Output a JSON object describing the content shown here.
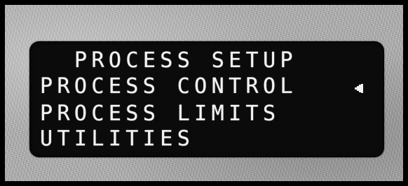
{
  "menu": {
    "title": "PROCESS SETUP",
    "items": [
      {
        "label": "PROCESS CONTROL",
        "selected": true
      },
      {
        "label": "PROCESS LIMITS",
        "selected": false
      },
      {
        "label": "UTILITIES",
        "selected": false
      }
    ]
  },
  "selection_indicator_icon": "left-pointing-triangle-cursor",
  "colors": {
    "screen": "#0b0b0b",
    "text": "#f2f2f2",
    "panel": "#b4b4b4",
    "border": "#000000"
  }
}
